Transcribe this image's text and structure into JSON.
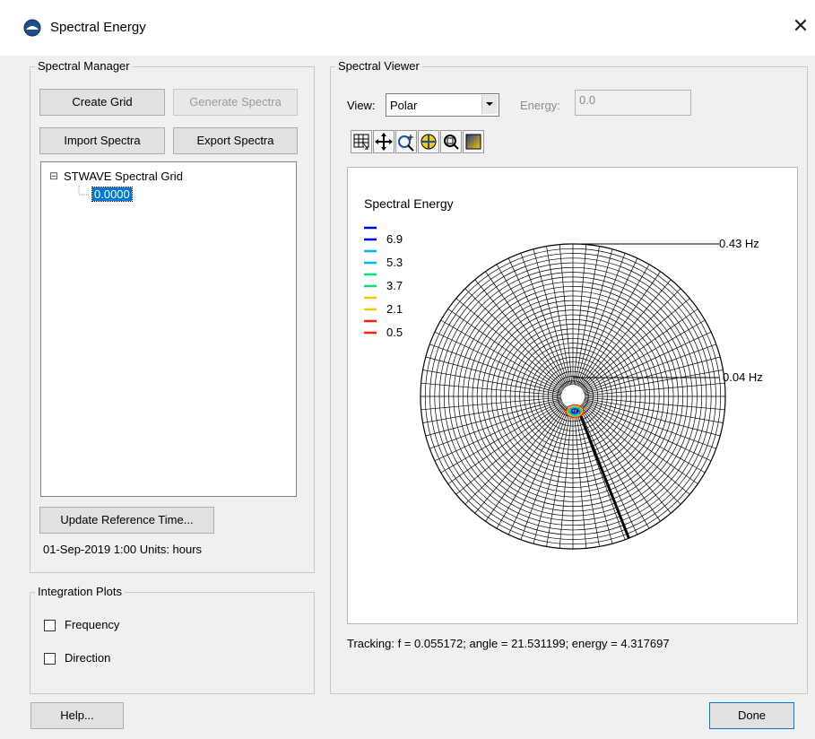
{
  "window": {
    "title": "Spectral Energy",
    "close_glyph": "✕"
  },
  "spectral_manager": {
    "group_title": "Spectral Manager",
    "create_grid": "Create Grid",
    "generate_spectra": "Generate Spectra",
    "import_spectra": "Import Spectra",
    "export_spectra": "Export Spectra",
    "tree": {
      "expander": "⊟",
      "root_label": "STWAVE Spectral Grid",
      "child_label": "0.0000"
    },
    "update_reference_time": "Update Reference Time...",
    "reference_time_text": "01-Sep-2019 1:00 Units: hours"
  },
  "integration_plots": {
    "group_title": "Integration Plots",
    "frequency_label": "Frequency",
    "direction_label": "Direction"
  },
  "spectral_viewer": {
    "group_title": "Spectral Viewer",
    "view_label": "View:",
    "view_value": "Polar",
    "energy_label": "Energy:",
    "energy_value": "0.0",
    "toolbar_icons": [
      "frame-icon",
      "pan-icon",
      "zoom-icon",
      "rotate-icon",
      "zoom-box-icon",
      "color-ramp-icon"
    ],
    "tracking_text": "Tracking: f = 0.055172; angle = 21.531199; energy = 4.317697"
  },
  "chart_data": {
    "type": "polar-contour",
    "title": "Spectral Energy",
    "legend": [
      {
        "value": "6.9",
        "color": "#0000ee"
      },
      {
        "value": "5.3",
        "color": "#00b4ff"
      },
      {
        "value": "3.7",
        "color": "#00e07a"
      },
      {
        "value": "2.1",
        "color": "#f5c800"
      },
      {
        "value": "0.5",
        "color": "#ff2000"
      }
    ],
    "radius_labels": {
      "outer": "0.43 Hz",
      "inner": "0.04 Hz"
    },
    "direction_lines": 72,
    "frequency_rings": 30,
    "peak": {
      "f": 0.055172,
      "angle": 21.531199,
      "energy": 4.317697
    }
  },
  "footer": {
    "help": "Help...",
    "done": "Done"
  }
}
